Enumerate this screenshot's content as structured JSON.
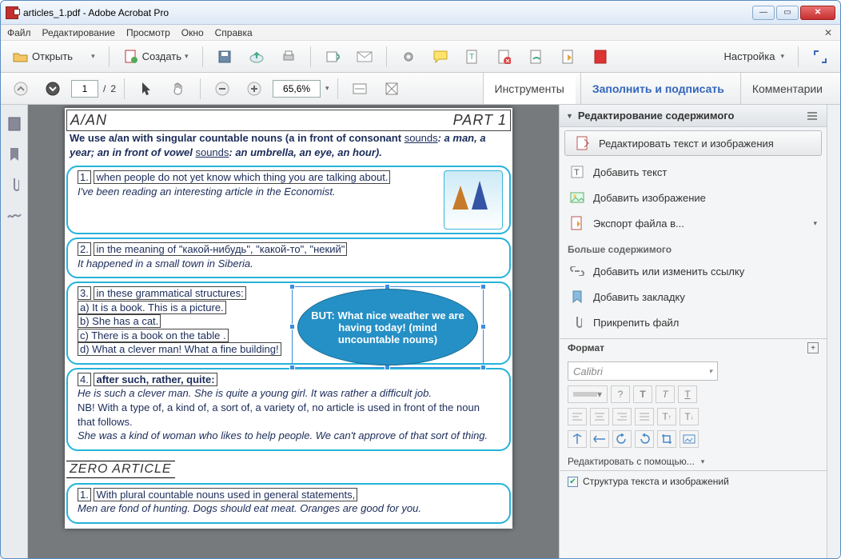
{
  "window": {
    "title": "articles_1.pdf - Adobe Acrobat Pro"
  },
  "menubar": {
    "file": "Файл",
    "edit": "Редактирование",
    "view": "Просмотр",
    "window": "Окно",
    "help": "Справка"
  },
  "toolbar": {
    "open": "Открыть",
    "create": "Создать",
    "customize": "Настройка"
  },
  "nav": {
    "page_current": "1",
    "page_sep": "/",
    "page_total": "2",
    "zoom": "65,6%"
  },
  "tabs": {
    "tools": "Инструменты",
    "fill_sign": "Заполнить и подписать",
    "comments": "Комментарии"
  },
  "doc": {
    "hdr_left": "A/AN",
    "hdr_right": "PART 1",
    "intro1": "We use a/an with singular countable nouns (a in front of consonant ",
    "intro_sounds": "sounds",
    "intro2": ": a man, a year; an in front of vowel ",
    "intro3": ": an umbrella, an eye, an hour).",
    "b1_n": "1.",
    "b1_a": "when people do not yet know which thing you are talking about.",
    "b1_b": "I've been reading an interesting article in the Economist.",
    "b2_n": "2.",
    "b2_a": "in the meaning of \"какой-нибудь\", \"какой-то\", \"некий\"",
    "b2_b": "It happened in a small town in Siberia.",
    "b3_n": "3.",
    "b3_a": "in these grammatical structures:",
    "b3_r1": "a) It is a book. This is a picture.",
    "b3_r2": "b) She has a cat.",
    "b3_r3": "c) There is a book on the table .",
    "b3_r4": "d) What a clever man! What a fine building!",
    "ellipse": "BUT: What nice weather we are having today! (mind uncountable nouns)",
    "b4_n": "4.",
    "b4_a": "after such, rather, quite:",
    "b4_l1": "He is such a clever man.   She is quite a young girl.   It was rather a difficult job.",
    "b4_l2": "NB! With a type of, a kind of, a sort of, a variety of, no article is used in front of the noun that follows.",
    "b4_l3": "She was a kind of woman who likes to help people.    We can't approve of that sort of thing.",
    "zero_title": "ZERO ARTICLE",
    "z1_n": "1.",
    "z1_a": "With plural countable nouns used in general statements,",
    "z1_b": "Men are fond of hunting.       Dogs should eat meat.       Oranges are good for you."
  },
  "panel": {
    "header": "Редактирование содержимого",
    "edit_text_img": "Редактировать текст и изображения",
    "add_text": "Добавить текст",
    "add_image": "Добавить изображение",
    "export": "Экспорт файла в...",
    "more": "Больше содержимого",
    "link": "Добавить или изменить ссылку",
    "bookmark": "Добавить закладку",
    "attach": "Прикрепить файл",
    "format_label": "Формат",
    "font": "Calibri",
    "edit_with": "Редактировать с помощью...",
    "structure": "Структура текста и изображений"
  }
}
